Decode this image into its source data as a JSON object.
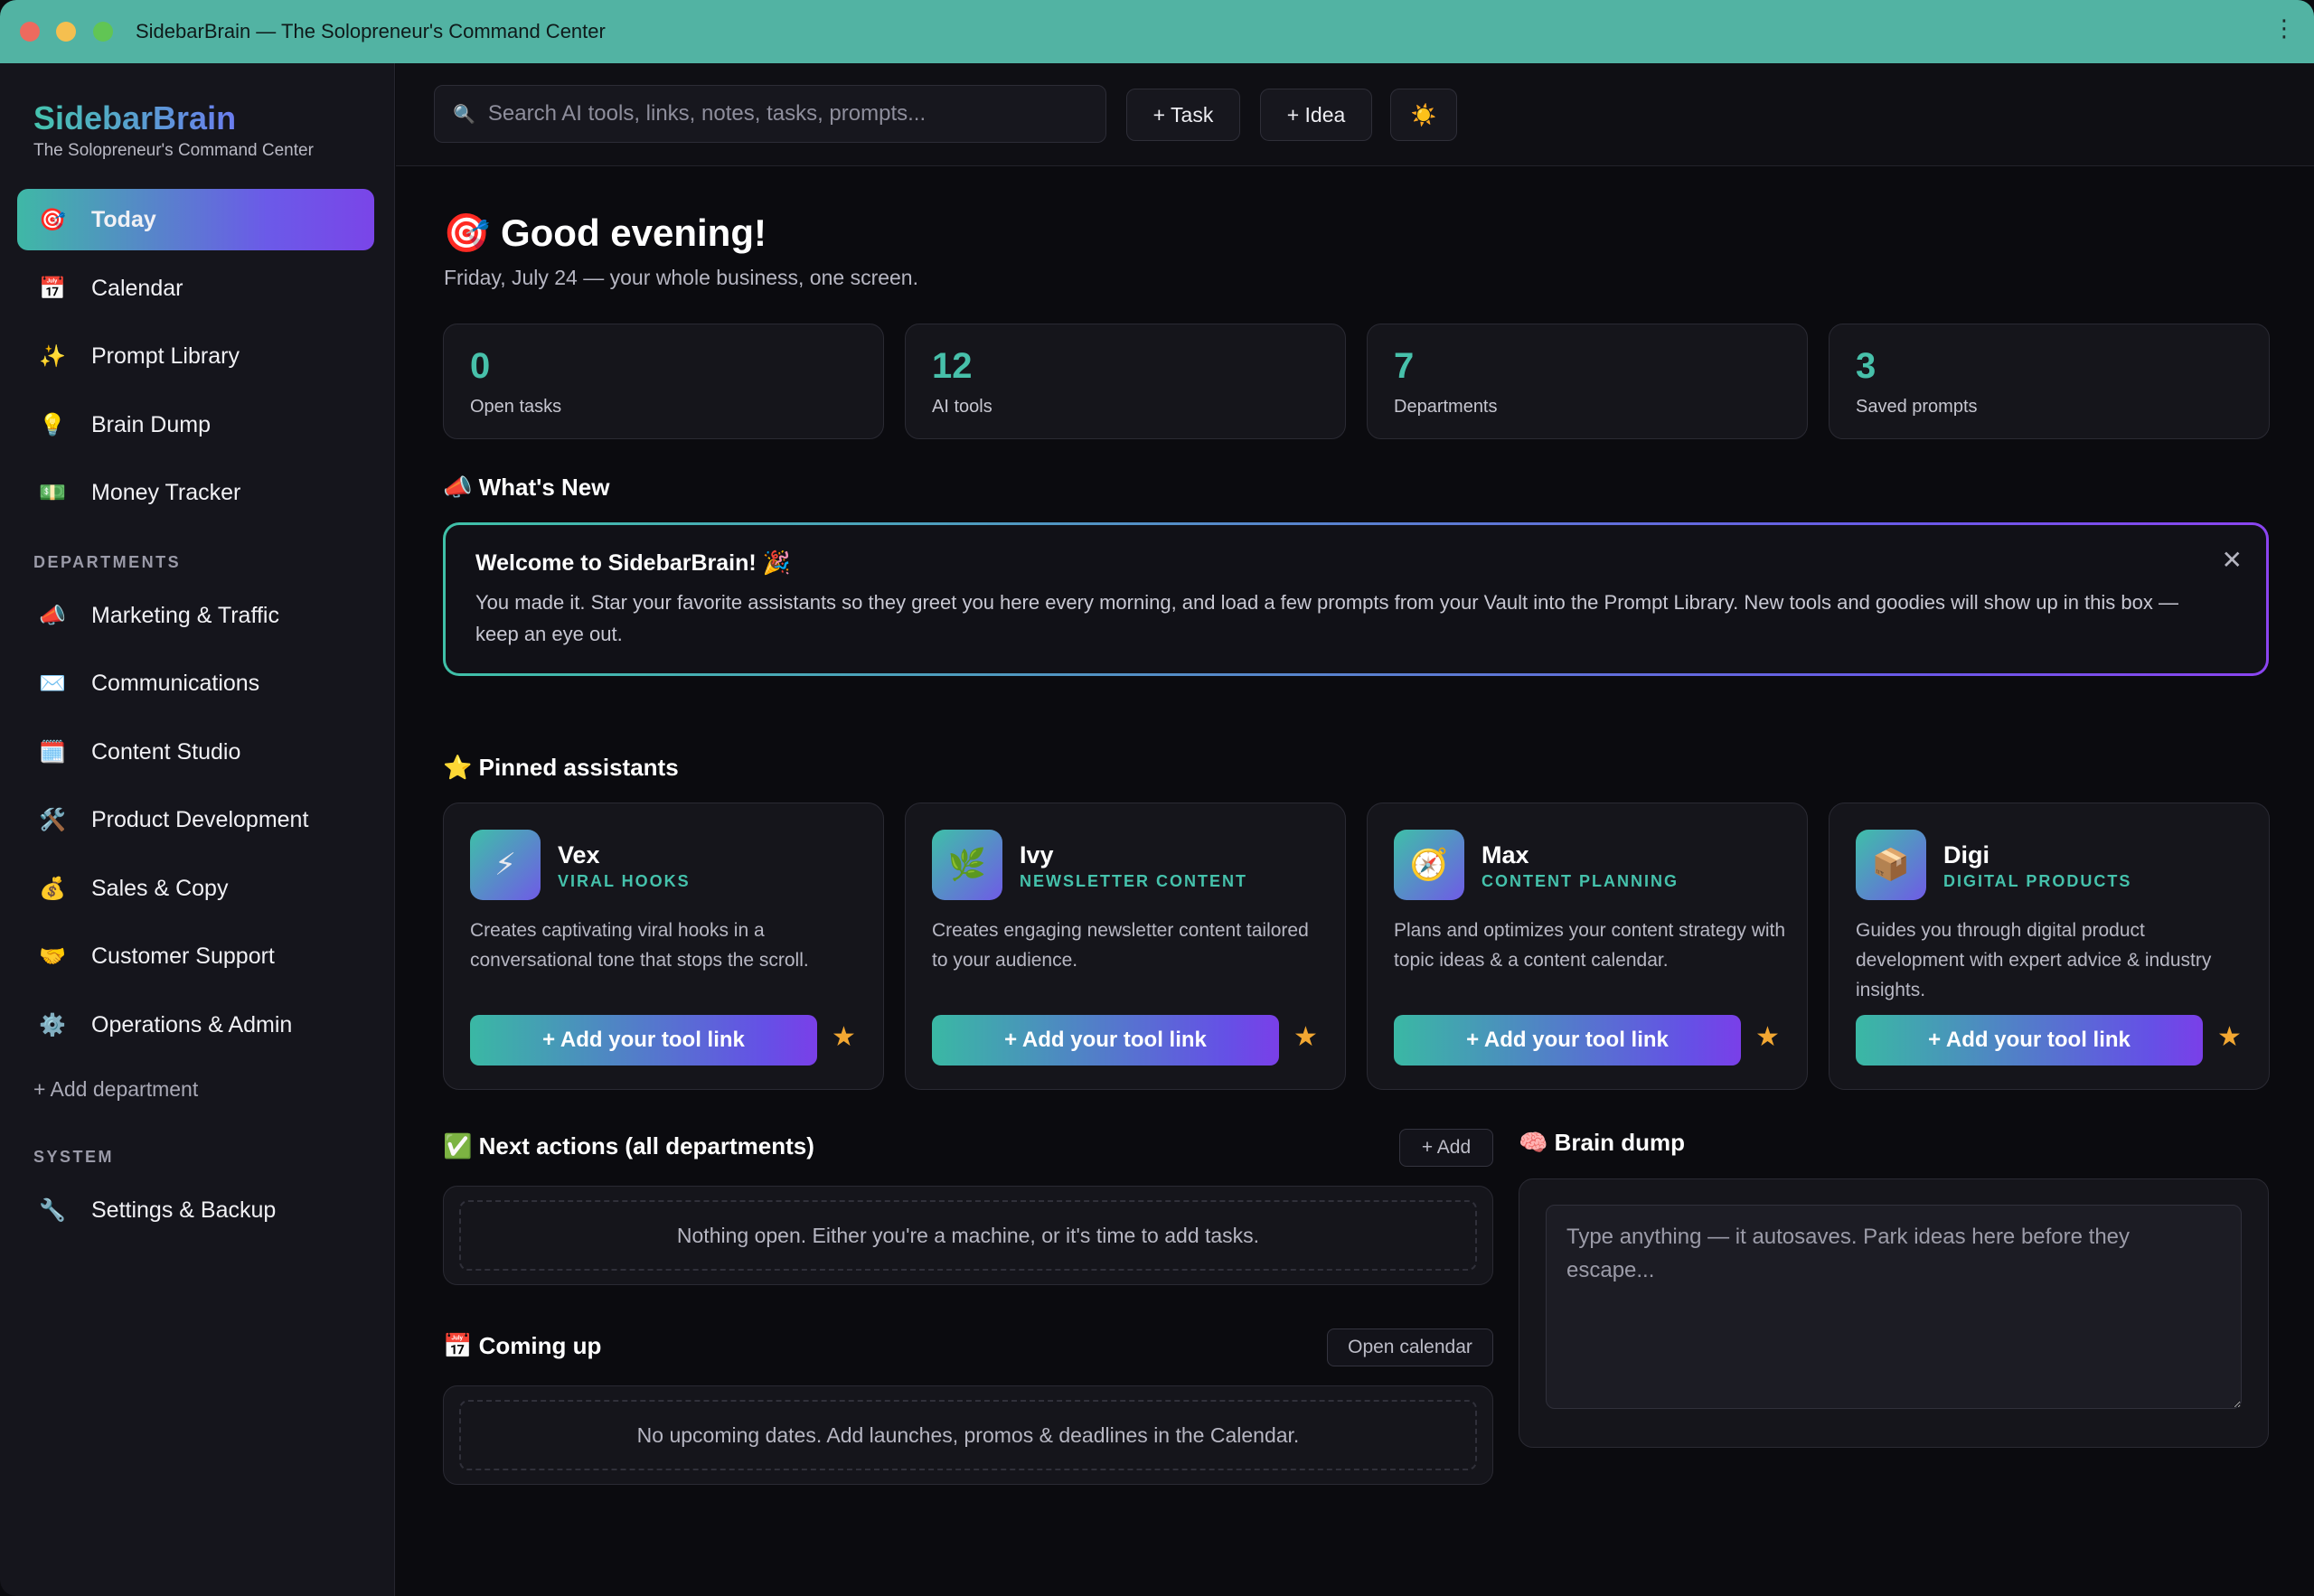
{
  "window": {
    "title": "SidebarBrain — The Solopreneur's Command Center",
    "menu_icon": "⋮"
  },
  "sidebar": {
    "brand": "SidebarBrain",
    "tagline": "The Solopreneur's Command Center",
    "main_items": [
      {
        "label": "Today",
        "icon": "🎯",
        "active": true
      },
      {
        "label": "Calendar",
        "icon": "📅"
      },
      {
        "label": "Prompt Library",
        "icon": "✨"
      },
      {
        "label": "Brain Dump",
        "icon": "💡"
      },
      {
        "label": "Money Tracker",
        "icon": "💵"
      }
    ],
    "departments_label": "DEPARTMENTS",
    "departments": [
      {
        "label": "Marketing & Traffic",
        "icon": "📣"
      },
      {
        "label": "Communications",
        "icon": "✉️"
      },
      {
        "label": "Content Studio",
        "icon": "🗓️"
      },
      {
        "label": "Product Development",
        "icon": "🛠️"
      },
      {
        "label": "Sales & Copy",
        "icon": "💰"
      },
      {
        "label": "Customer Support",
        "icon": "🤝"
      },
      {
        "label": "Operations & Admin",
        "icon": "⚙️"
      }
    ],
    "add_department": "+ Add department",
    "system_label": "SYSTEM",
    "system_items": [
      {
        "label": "Settings & Backup",
        "icon": "🔧"
      }
    ]
  },
  "topbar": {
    "search_placeholder": "Search AI tools, links, notes, tasks, prompts...",
    "task_button": "+ Task",
    "idea_button": "+ Idea",
    "theme_icon": "☀️"
  },
  "main": {
    "greeting_icon": "🎯",
    "greeting": "Good evening!",
    "subtitle": "Friday, July 24 — your whole business, one screen.",
    "stats": [
      {
        "value": "0",
        "label": "Open tasks"
      },
      {
        "value": "12",
        "label": "AI tools"
      },
      {
        "value": "7",
        "label": "Departments"
      },
      {
        "value": "3",
        "label": "Saved prompts"
      }
    ],
    "whats_new": {
      "heading": "📣 What's New",
      "title": "Welcome to SidebarBrain! 🎉",
      "body": "You made it. Star your favorite assistants so they greet you here every morning, and load a few prompts from your Vault into the Prompt Library. New tools and goodies will show up in this box — keep an eye out.",
      "close_icon": "✕"
    },
    "pinned": {
      "heading": "⭐ Pinned assistants",
      "assistants": [
        {
          "name": "Vex",
          "role": "VIRAL HOOKS",
          "icon": "⚡",
          "desc": "Creates captivating viral hooks in a conversational tone that stops the scroll.",
          "button": "+ Add your tool link",
          "star": "★"
        },
        {
          "name": "Ivy",
          "role": "NEWSLETTER CONTENT",
          "icon": "🌿",
          "desc": "Creates engaging newsletter content tailored to your audience.",
          "button": "+ Add your tool link",
          "star": "★"
        },
        {
          "name": "Max",
          "role": "CONTENT PLANNING",
          "icon": "🧭",
          "desc": "Plans and optimizes your content strategy with topic ideas & a content calendar.",
          "button": "+ Add your tool link",
          "star": "★"
        },
        {
          "name": "Digi",
          "role": "DIGITAL PRODUCTS",
          "icon": "📦",
          "desc": "Guides you through digital product development with expert advice & industry insights.",
          "button": "+ Add your tool link",
          "star": "★"
        }
      ]
    },
    "next_actions": {
      "heading": "✅ Next actions (all departments)",
      "add_button": "+ Add",
      "empty": "Nothing open. Either you're a machine, or it's time to add tasks."
    },
    "coming_up": {
      "heading": "📅 Coming up",
      "button": "Open calendar",
      "empty": "No upcoming dates. Add launches, promos & deadlines in the Calendar."
    },
    "brain_dump": {
      "heading": "🧠 Brain dump",
      "placeholder": "Type anything — it autosaves. Park ideas here before they escape..."
    }
  },
  "colors": {
    "accent_teal": "#45c2ac",
    "accent_purple": "#6b50e6",
    "star": "#f2a732",
    "titlebar": "#52b3a3"
  }
}
